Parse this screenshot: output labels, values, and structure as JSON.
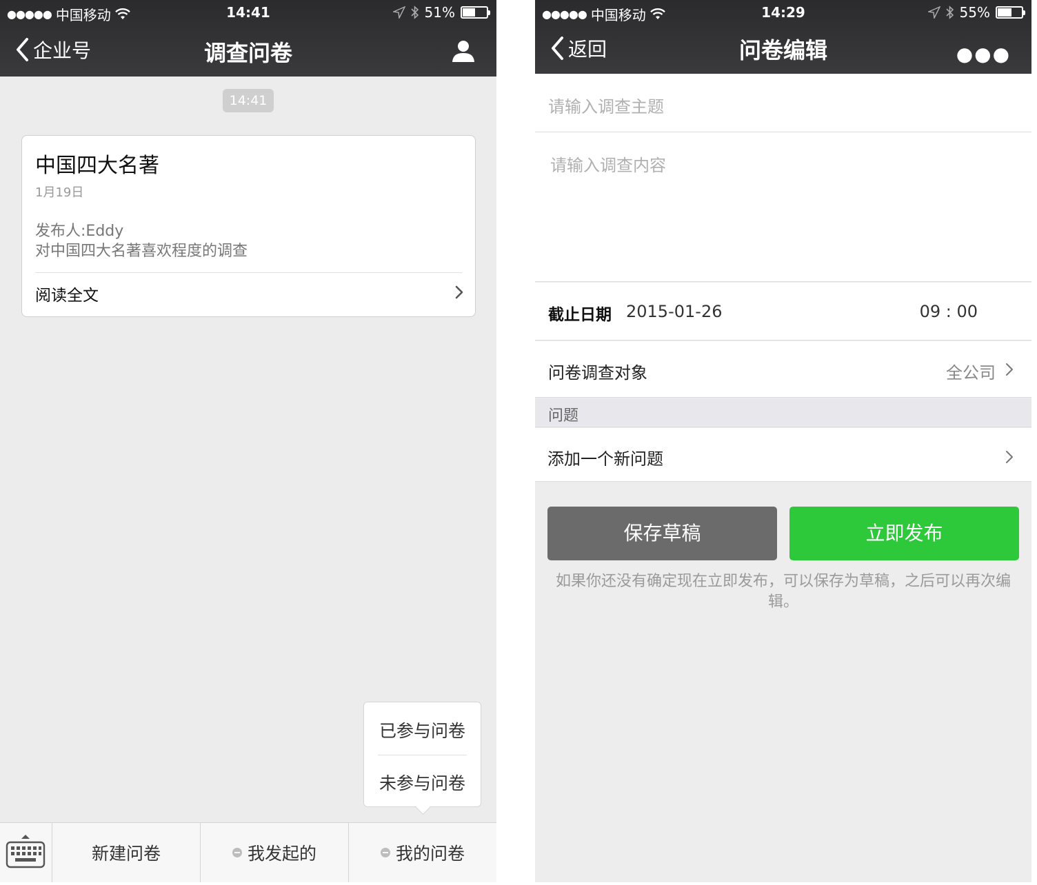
{
  "left": {
    "status": {
      "carrier": "中国移动",
      "time": "14:41",
      "battery": "51%",
      "battery_level": 0.51
    },
    "nav": {
      "back_label": "企业号",
      "title": "调查问卷",
      "icon": "user-icon"
    },
    "timestamp": "14:41",
    "card": {
      "title": "中国四大名著",
      "date": "1月19日",
      "publisher": "发布人:Eddy",
      "description": "对中国四大名著喜欢程度的调查",
      "read_label": "阅读全文"
    },
    "popup": {
      "items": [
        "已参与问卷",
        "未参与问卷"
      ]
    },
    "tabbar": {
      "keyboard_icon": "keyboard-icon",
      "items": [
        "新建问卷",
        "我发起的",
        "我的问卷"
      ]
    }
  },
  "right": {
    "status": {
      "carrier": "中国移动",
      "time": "14:29",
      "battery": "55%",
      "battery_level": 0.55
    },
    "nav": {
      "back_label": "返回",
      "title": "问卷编辑",
      "icon": "more-icon"
    },
    "form": {
      "title_placeholder": "请输入调查主题",
      "content_placeholder": "请输入调查内容",
      "deadline_label": "截止日期",
      "deadline_date": "2015-01-26",
      "deadline_time": "09 : 00",
      "target_label": "问卷调查对象",
      "target_value": "全公司",
      "section_label": "问题",
      "add_question_label": "添加一个新问题"
    },
    "buttons": {
      "save_draft": "保存草稿",
      "publish": "立即发布"
    },
    "hint": "如果你还没有确定现在立即发布，可以保存为草稿，之后可以再次编辑。"
  },
  "colors": {
    "navbar": "#2b2b2d",
    "publish_green": "#2ec93b",
    "draft_gray": "#6b6b6b",
    "background": "#ececec"
  }
}
